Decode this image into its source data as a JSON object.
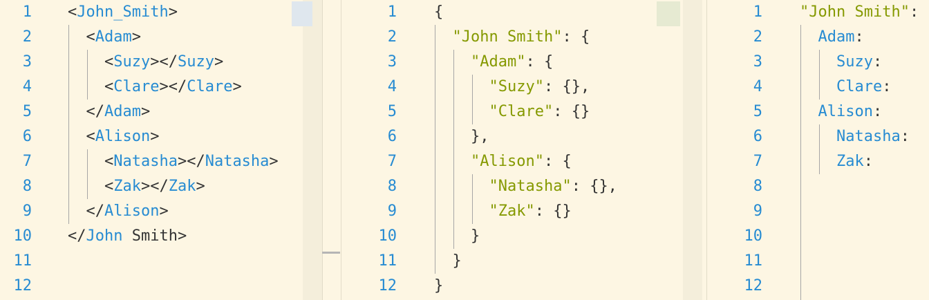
{
  "panes": [
    {
      "name": "xml",
      "line_numbers": [
        "1",
        "2",
        "3",
        "4",
        "5",
        "6",
        "7",
        "8",
        "9",
        "10",
        "11",
        "12"
      ],
      "lines": [
        [
          {
            "t": "<",
            "c": "punc"
          },
          {
            "t": "John_Smith",
            "c": "tag"
          },
          {
            "t": ">",
            "c": "punc"
          }
        ],
        [
          {
            "t": "  <",
            "c": "punc"
          },
          {
            "t": "Adam",
            "c": "tag"
          },
          {
            "t": ">",
            "c": "punc"
          }
        ],
        [
          {
            "t": "    <",
            "c": "punc"
          },
          {
            "t": "Suzy",
            "c": "tag"
          },
          {
            "t": "></",
            "c": "punc"
          },
          {
            "t": "Suzy",
            "c": "tag"
          },
          {
            "t": ">",
            "c": "punc"
          }
        ],
        [
          {
            "t": "    <",
            "c": "punc"
          },
          {
            "t": "Clare",
            "c": "tag"
          },
          {
            "t": "></",
            "c": "punc"
          },
          {
            "t": "Clare",
            "c": "tag"
          },
          {
            "t": ">",
            "c": "punc"
          }
        ],
        [
          {
            "t": "  </",
            "c": "punc"
          },
          {
            "t": "Adam",
            "c": "tag"
          },
          {
            "t": ">",
            "c": "punc"
          }
        ],
        [
          {
            "t": "  <",
            "c": "punc"
          },
          {
            "t": "Alison",
            "c": "tag"
          },
          {
            "t": ">",
            "c": "punc"
          }
        ],
        [
          {
            "t": "    <",
            "c": "punc"
          },
          {
            "t": "Natasha",
            "c": "tag"
          },
          {
            "t": "></",
            "c": "punc"
          },
          {
            "t": "Natasha",
            "c": "tag"
          },
          {
            "t": ">",
            "c": "punc"
          }
        ],
        [
          {
            "t": "    <",
            "c": "punc"
          },
          {
            "t": "Zak",
            "c": "tag"
          },
          {
            "t": "></",
            "c": "punc"
          },
          {
            "t": "Zak",
            "c": "tag"
          },
          {
            "t": ">",
            "c": "punc"
          }
        ],
        [
          {
            "t": "  </",
            "c": "punc"
          },
          {
            "t": "Alison",
            "c": "tag"
          },
          {
            "t": ">",
            "c": "punc"
          }
        ],
        [
          {
            "t": "</",
            "c": "punc"
          },
          {
            "t": "John",
            "c": "tag"
          },
          {
            "t": " Smith>",
            "c": "punc"
          }
        ],
        [],
        []
      ]
    },
    {
      "name": "json",
      "line_numbers": [
        "1",
        "2",
        "3",
        "4",
        "5",
        "6",
        "7",
        "8",
        "9",
        "10",
        "11",
        "12"
      ],
      "lines": [
        [
          {
            "t": "{",
            "c": "punc"
          }
        ],
        [
          {
            "t": "  ",
            "c": "punc"
          },
          {
            "t": "\"John Smith\"",
            "c": "str"
          },
          {
            "t": ": {",
            "c": "punc"
          }
        ],
        [
          {
            "t": "    ",
            "c": "punc"
          },
          {
            "t": "\"Adam\"",
            "c": "str"
          },
          {
            "t": ": {",
            "c": "punc"
          }
        ],
        [
          {
            "t": "      ",
            "c": "punc"
          },
          {
            "t": "\"Suzy\"",
            "c": "str"
          },
          {
            "t": ": {},",
            "c": "punc"
          }
        ],
        [
          {
            "t": "      ",
            "c": "punc"
          },
          {
            "t": "\"Clare\"",
            "c": "str"
          },
          {
            "t": ": {}",
            "c": "punc"
          }
        ],
        [
          {
            "t": "    },",
            "c": "punc"
          }
        ],
        [
          {
            "t": "    ",
            "c": "punc"
          },
          {
            "t": "\"Alison\"",
            "c": "str"
          },
          {
            "t": ": {",
            "c": "punc"
          }
        ],
        [
          {
            "t": "      ",
            "c": "punc"
          },
          {
            "t": "\"Natasha\"",
            "c": "str"
          },
          {
            "t": ": {},",
            "c": "punc"
          }
        ],
        [
          {
            "t": "      ",
            "c": "punc"
          },
          {
            "t": "\"Zak\"",
            "c": "str"
          },
          {
            "t": ": {}",
            "c": "punc"
          }
        ],
        [
          {
            "t": "    }",
            "c": "punc"
          }
        ],
        [
          {
            "t": "  }",
            "c": "punc"
          }
        ],
        [
          {
            "t": "}",
            "c": "punc"
          }
        ]
      ]
    },
    {
      "name": "yaml",
      "line_numbers": [
        "1",
        "2",
        "3",
        "4",
        "5",
        "6",
        "7",
        "8",
        "9",
        "10",
        "11",
        "12"
      ],
      "lines": [
        [
          {
            "t": "\"John Smith\"",
            "c": "str"
          },
          {
            "t": ":",
            "c": "punc"
          }
        ],
        [
          {
            "t": "  ",
            "c": "punc"
          },
          {
            "t": "Adam",
            "c": "key"
          },
          {
            "t": ":",
            "c": "punc"
          }
        ],
        [
          {
            "t": "    ",
            "c": "punc"
          },
          {
            "t": "Suzy",
            "c": "key"
          },
          {
            "t": ":",
            "c": "punc"
          }
        ],
        [
          {
            "t": "    ",
            "c": "punc"
          },
          {
            "t": "Clare",
            "c": "key"
          },
          {
            "t": ":",
            "c": "punc"
          }
        ],
        [
          {
            "t": "  ",
            "c": "punc"
          },
          {
            "t": "Alison",
            "c": "key"
          },
          {
            "t": ":",
            "c": "punc"
          }
        ],
        [
          {
            "t": "    ",
            "c": "punc"
          },
          {
            "t": "Natasha",
            "c": "key"
          },
          {
            "t": ":",
            "c": "punc"
          }
        ],
        [
          {
            "t": "    ",
            "c": "punc"
          },
          {
            "t": "Zak",
            "c": "key"
          },
          {
            "t": ":",
            "c": "punc"
          }
        ],
        [],
        [],
        [],
        [],
        []
      ]
    }
  ],
  "colors": {
    "background": "#fdf6e3",
    "line_number": "#268bd2",
    "tag": "#268bd2",
    "string": "#859900",
    "key": "#268bd2",
    "punctuation": "#333333",
    "indent_guide": "#a6a6a6"
  }
}
